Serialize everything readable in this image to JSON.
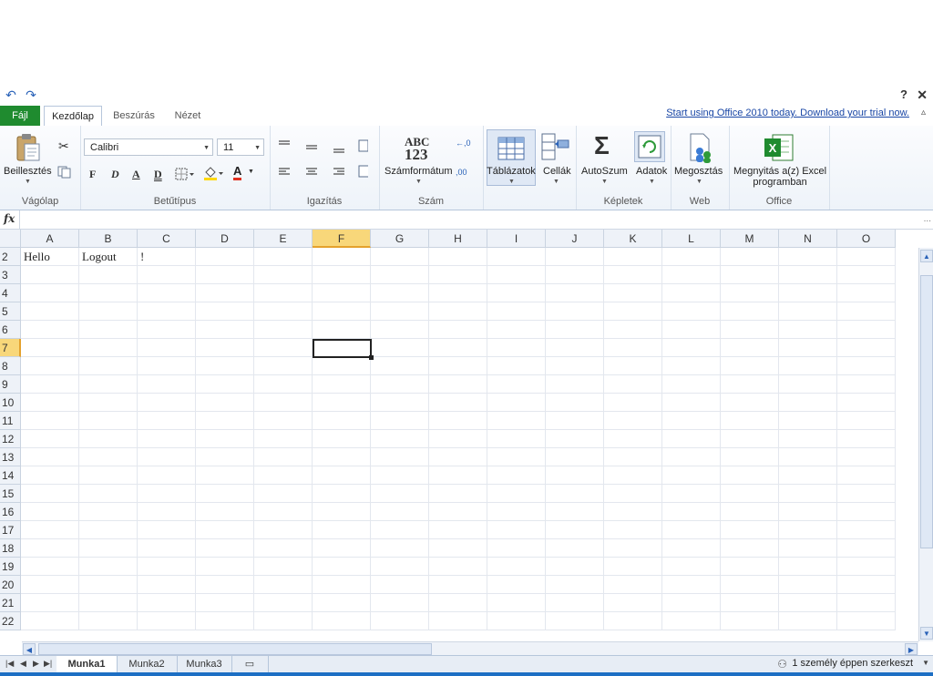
{
  "qat": {
    "undo_icon": "undo-icon",
    "redo_icon": "redo-icon",
    "help": "?",
    "close": "✕"
  },
  "tabs": {
    "file": "Fájl",
    "items": [
      "Kezdőlap",
      "Beszúrás",
      "Nézet"
    ],
    "trial_link": "Start using Office 2010 today. Download your trial now."
  },
  "ribbon": {
    "clipboard": {
      "paste_label": "Beillesztés",
      "group": "Vágólap"
    },
    "font": {
      "name": "Calibri",
      "size": "11",
      "bold": "F",
      "italic": "D",
      "underline": "A",
      "double_underline": "D",
      "color_letter": "A",
      "group": "Betűtípus"
    },
    "alignment": {
      "group": "Igazítás"
    },
    "number": {
      "abc": "ABC",
      "num": "123",
      "label": "Számformátum",
      "group": "Szám"
    },
    "tables": {
      "tables_label": "Táblázatok",
      "cells_label": "Cellák"
    },
    "formulas": {
      "autosum_label": "AutoSzum",
      "sigma": "Σ",
      "data_label": "Adatok",
      "group": "Képletek"
    },
    "web": {
      "share_label": "Megosztás",
      "group": "Web"
    },
    "office": {
      "open_label_1": "Megnyitás a(z) Excel",
      "open_label_2": "programban",
      "group": "Office"
    },
    "accent": "#1f8b2f"
  },
  "formula_bar": {
    "fx": "fx",
    "value": ""
  },
  "grid": {
    "columns": [
      "A",
      "B",
      "C",
      "D",
      "E",
      "F",
      "G",
      "H",
      "I",
      "J",
      "K",
      "L",
      "M",
      "N",
      "O"
    ],
    "rows": [
      "2",
      "3",
      "4",
      "5",
      "6",
      "7",
      "8",
      "9",
      "10",
      "11",
      "12",
      "13",
      "14",
      "15",
      "16",
      "17",
      "18",
      "19",
      "20",
      "21",
      "22"
    ],
    "selected_column": "F",
    "selected_row": "7",
    "cells": {
      "A2": "Hello",
      "B2": "Logout",
      "C2": "!"
    }
  },
  "sheets": {
    "tabs": [
      "Munka1",
      "Munka2",
      "Munka3"
    ],
    "active": "Munka1"
  },
  "status": {
    "text": "1 személy éppen szerkeszt"
  }
}
